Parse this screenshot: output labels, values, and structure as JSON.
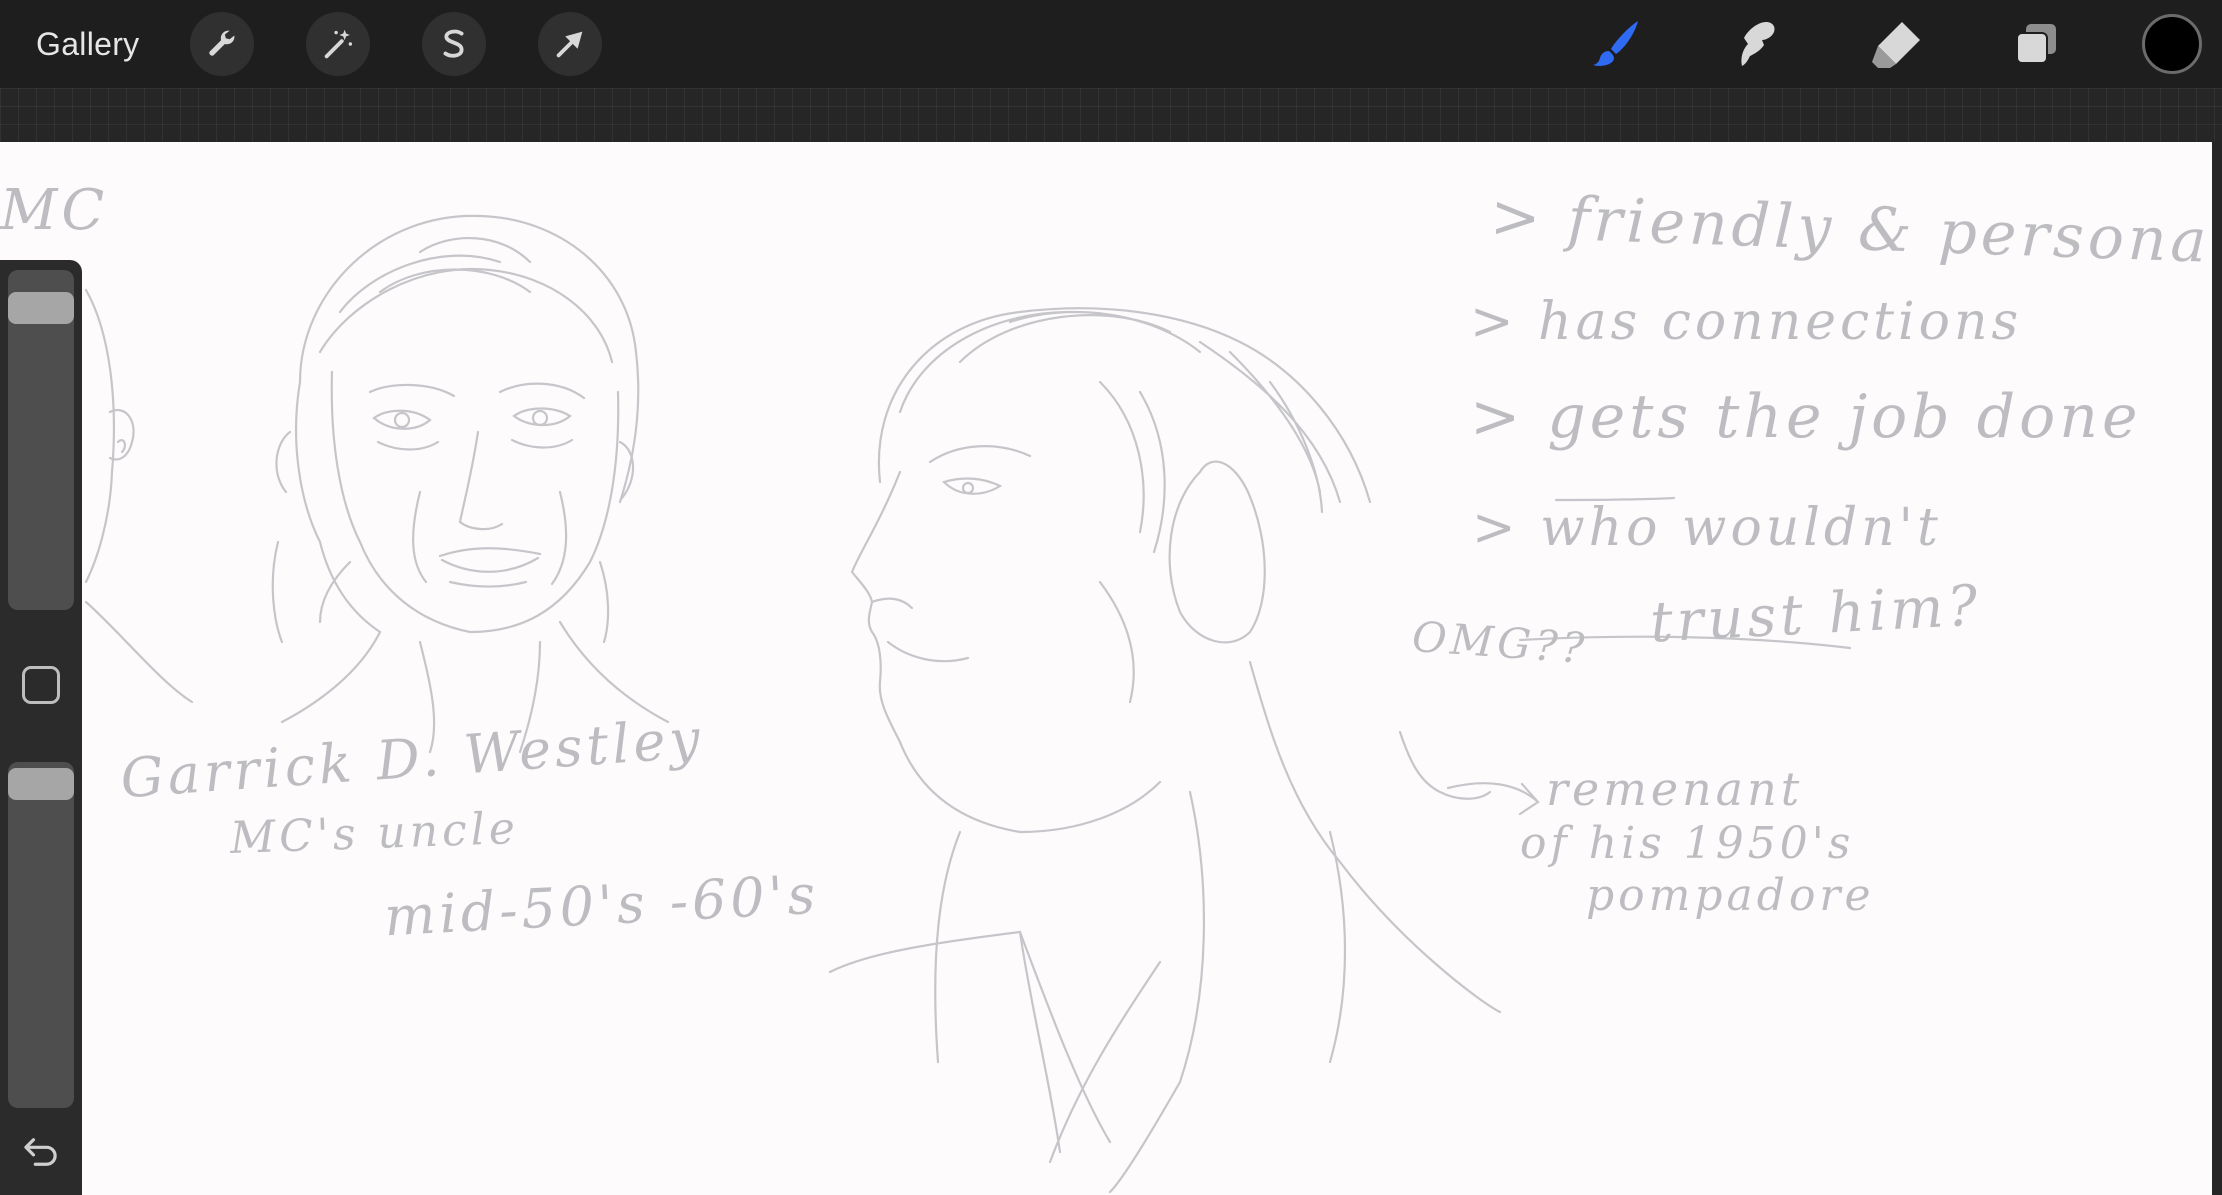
{
  "toolbar": {
    "gallery_label": "Gallery",
    "left_tools": [
      "wrench-icon",
      "magic-wand-icon",
      "selection-s-icon",
      "transform-arrow-icon"
    ],
    "right_tools": [
      "brush-icon",
      "smudge-icon",
      "eraser-icon",
      "layers-icon"
    ],
    "active_tool": "brush-icon",
    "active_color": "#000000",
    "accent_color": "#2e6bf2"
  },
  "sidebar": {
    "brush_size": 0.07,
    "brush_opacity": 0.02,
    "modify_icon": "square-icon",
    "undo_icon": "undo-icon"
  },
  "canvas": {
    "background_color": "#fdfbfc",
    "ink_color": "#bdbdc1",
    "notes": {
      "corner_text": "MC",
      "name": "Garrick D. Westley",
      "relation": "MC's uncle",
      "age": "mid-50's -60's",
      "trait1": "> friendly & personable",
      "trait2": "> has connections",
      "trait3": "> gets the job done",
      "trait4a": "> who wouldn't",
      "trait4b": "trust him?",
      "omg": "OMG??",
      "hair1": "remenant",
      "hair2": "of his 1950's",
      "hair3": "pompadore"
    }
  }
}
